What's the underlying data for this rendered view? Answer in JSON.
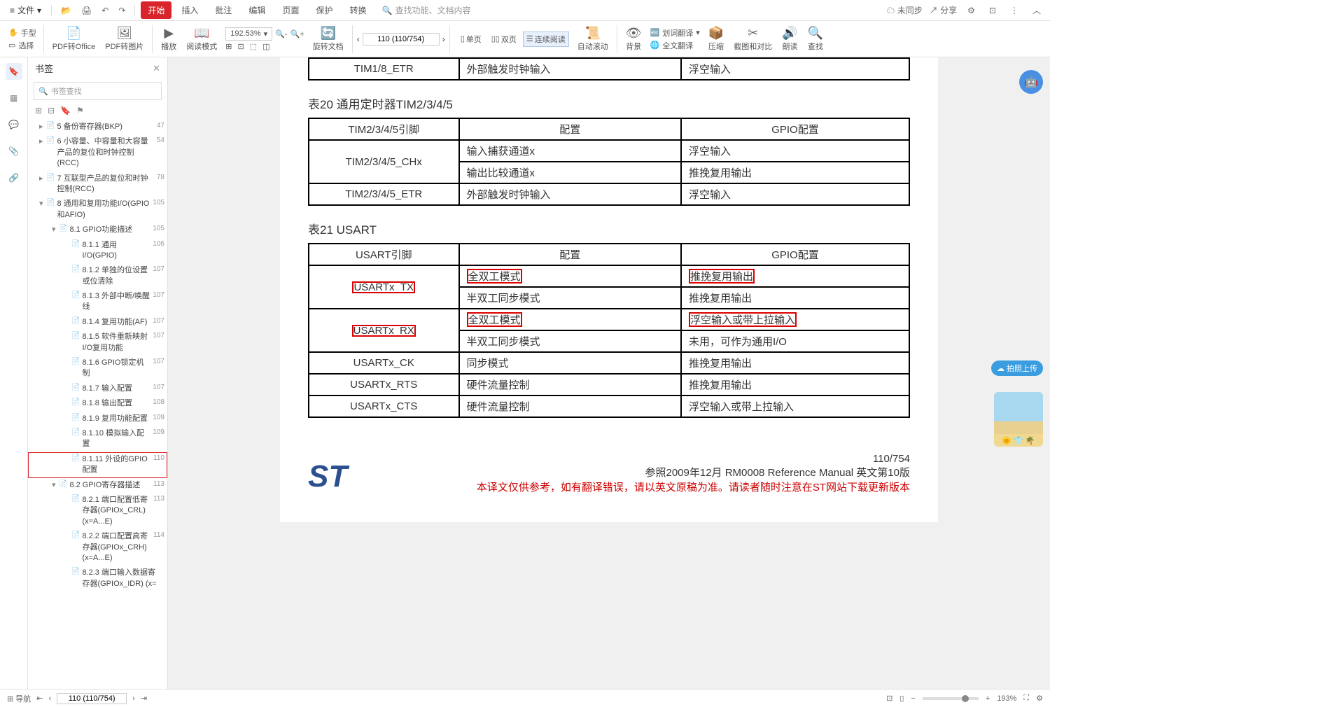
{
  "menubar": {
    "file": "文件",
    "tabs": [
      "开始",
      "插入",
      "批注",
      "编辑",
      "页面",
      "保护",
      "转换"
    ],
    "active_tab": 0,
    "search_placeholder": "查找功能、文档内容",
    "sync": "未同步",
    "share": "分享"
  },
  "ribbon": {
    "hand": "手型",
    "select": "选择",
    "pdf2office": "PDF转Office",
    "pdf2img": "PDF转图片",
    "play": "播放",
    "readmode": "阅读模式",
    "zoom": "192.53%",
    "rotate": "旋转文档",
    "page_input": "110 (110/754)",
    "single": "单页",
    "double": "双页",
    "continuous": "连续阅读",
    "autoscroll": "自动滚动",
    "background": "背景",
    "linetrans": "划词翻译",
    "fulltrans": "全文翻译",
    "compress": "压缩",
    "crop": "截图和对比",
    "read": "朗读",
    "find": "查找"
  },
  "bookmarks": {
    "title": "书签",
    "search_placeholder": "书签查找",
    "tree": [
      {
        "l": 1,
        "t": "▸",
        "label": "5 备份寄存器(BKP)",
        "pg": "47"
      },
      {
        "l": 1,
        "t": "▸",
        "label": "6 小容量、中容量和大容量产品的复位和时钟控制(RCC)",
        "pg": "54"
      },
      {
        "l": 1,
        "t": "▸",
        "label": "7 互联型产品的复位和时钟控制(RCC)",
        "pg": "78"
      },
      {
        "l": 1,
        "t": "▾",
        "label": "8 通用和复用功能I/O(GPIO和AFIO)",
        "pg": "105"
      },
      {
        "l": 2,
        "t": "▾",
        "label": "8.1 GPIO功能描述",
        "pg": "105"
      },
      {
        "l": 3,
        "t": "",
        "label": "8.1.1 通用I/O(GPIO)",
        "pg": "106"
      },
      {
        "l": 3,
        "t": "",
        "label": "8.1.2 单独的位设置或位清除",
        "pg": "107"
      },
      {
        "l": 3,
        "t": "",
        "label": "8.1.3 外部中断/唤醒线",
        "pg": "107"
      },
      {
        "l": 3,
        "t": "",
        "label": "8.1.4 复用功能(AF)",
        "pg": "107"
      },
      {
        "l": 3,
        "t": "",
        "label": "8.1.5 软件重新映射I/O复用功能",
        "pg": "107"
      },
      {
        "l": 3,
        "t": "",
        "label": "8.1.6 GPIO锁定机制",
        "pg": "107"
      },
      {
        "l": 3,
        "t": "",
        "label": "8.1.7 输入配置",
        "pg": "107"
      },
      {
        "l": 3,
        "t": "",
        "label": "8.1.8 输出配置",
        "pg": "108"
      },
      {
        "l": 3,
        "t": "",
        "label": "8.1.9 复用功能配置",
        "pg": "109"
      },
      {
        "l": 3,
        "t": "",
        "label": "8.1.10 模拟输入配置",
        "pg": "109"
      },
      {
        "l": 3,
        "t": "",
        "label": "8.1.11 外设的GPIO配置",
        "pg": "110",
        "selected": true
      },
      {
        "l": 2,
        "t": "▾",
        "label": "8.2 GPIO寄存器描述",
        "pg": "113"
      },
      {
        "l": 3,
        "t": "",
        "label": "8.2.1 端口配置低寄存器(GPIOx_CRL) (x=A...E)",
        "pg": "113"
      },
      {
        "l": 3,
        "t": "",
        "label": "8.2.2 端口配置高寄存器(GPIOx_CRH) (x=A...E)",
        "pg": "114"
      },
      {
        "l": 3,
        "t": "",
        "label": "8.2.3 端口输入数据寄存器(GPIOx_IDR) (x=",
        "pg": ""
      }
    ]
  },
  "doc": {
    "table19_row": [
      "TIM1/8_ETR",
      "外部触发时钟输入",
      "浮空输入"
    ],
    "caption20": "表20    通用定时器TIM2/3/4/5",
    "table20": {
      "headers": [
        "TIM2/3/4/5引脚",
        "配置",
        "GPIO配置"
      ],
      "rows": [
        {
          "pin": "TIM2/3/4/5_CHx",
          "rowspan": 2,
          "cfg": "输入捕获通道x",
          "gpio": "浮空输入"
        },
        {
          "cfg": "输出比较通道x",
          "gpio": "推挽复用输出"
        },
        {
          "pin": "TIM2/3/4/5_ETR",
          "cfg": "外部触发时钟输入",
          "gpio": "浮空输入"
        }
      ]
    },
    "caption21": "表21    USART",
    "table21": {
      "headers": [
        "USART引脚",
        "配置",
        "GPIO配置"
      ],
      "rows": [
        {
          "pin": "USARTx_TX",
          "pinred": true,
          "rowspan": 2,
          "cfg": "全双工模式",
          "cfgred": true,
          "gpio": "推挽复用输出",
          "gpiored": true
        },
        {
          "cfg": "半双工同步模式",
          "gpio": "推挽复用输出"
        },
        {
          "pin": "USARTx_RX",
          "pinred": true,
          "rowspan": 2,
          "cfg": "全双工模式",
          "cfgred": true,
          "gpio": "浮空输入或带上拉输入",
          "gpiored": true
        },
        {
          "cfg": "半双工同步模式",
          "gpio": "未用，可作为通用I/O"
        },
        {
          "pin": "USARTx_CK",
          "cfg": "同步模式",
          "gpio": "推挽复用输出"
        },
        {
          "pin": "USARTx_RTS",
          "cfg": "硬件流量控制",
          "gpio": "推挽复用输出"
        },
        {
          "pin": "USARTx_CTS",
          "cfg": "硬件流量控制",
          "gpio": "浮空输入或带上拉输入"
        }
      ]
    },
    "footer": {
      "page": "110/754",
      "ref": "参照2009年12月  RM0008 Reference Manual  英文第10版",
      "note": "本译文仅供参考，如有翻译错误，请以英文原稿为准。请读者随时注意在ST网站下载更新版本"
    }
  },
  "upload": "拍照上传",
  "status": {
    "nav": "导航",
    "page": "110 (110/754)",
    "zoom": "193%"
  }
}
